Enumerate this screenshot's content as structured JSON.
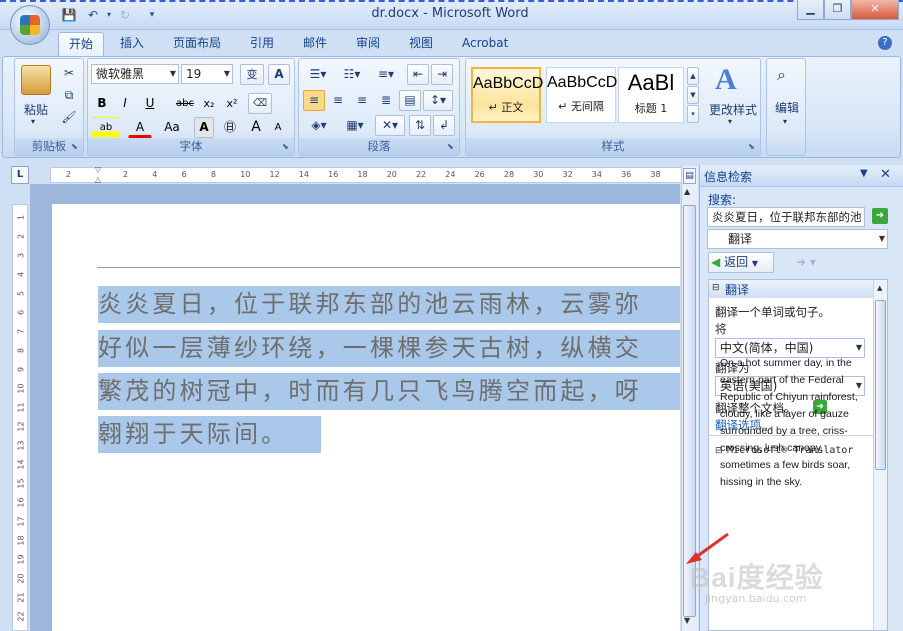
{
  "window": {
    "title": "dr.docx - Microsoft Word"
  },
  "tabs": [
    "开始",
    "插入",
    "页面布局",
    "引用",
    "邮件",
    "审阅",
    "视图",
    "Acrobat"
  ],
  "clipboard": {
    "paste": "粘贴",
    "group": "剪贴板"
  },
  "font": {
    "name": "微软雅黑",
    "size": "19",
    "group": "字体",
    "bold": "B",
    "italic": "I",
    "underline": "U",
    "strike": "abc",
    "sub": "x₂",
    "sup": "x²",
    "case": "Aa",
    "grow": "A",
    "shrink": "A",
    "wen": "变"
  },
  "paragraph": {
    "group": "段落"
  },
  "styles": {
    "group": "样式",
    "tiles": [
      {
        "sample": "AaBbCcD",
        "name": "↵ 正文"
      },
      {
        "sample": "AaBbCcD",
        "name": "↵ 无间隔"
      },
      {
        "sample": "AaBl",
        "name": "标题 1"
      }
    ],
    "change": "更改样式"
  },
  "editing": {
    "label": "编辑"
  },
  "ruler": {
    "corner": "L",
    "ticks": [
      "2",
      "2",
      "4",
      "6",
      "8",
      "10",
      "12",
      "14",
      "16",
      "18",
      "20",
      "22",
      "24",
      "26",
      "28",
      "30",
      "32",
      "34",
      "36",
      "38"
    ],
    "vticks": [
      "1",
      "2",
      "3",
      "4",
      "5",
      "6",
      "7",
      "8",
      "9",
      "10",
      "11",
      "12",
      "13",
      "14",
      "15",
      "16",
      "17",
      "18",
      "19",
      "20",
      "21",
      "22"
    ]
  },
  "doc": {
    "lines": [
      "炎炎夏日，位于联邦东部的池云雨林，云雾弥",
      "好似一层薄纱环绕，一棵棵参天古树，纵横交",
      "繁茂的树冠中，时而有几只飞鸟腾空而起，呀",
      "翱翔于天际间。"
    ]
  },
  "pane": {
    "title": "信息检索",
    "search_label": "搜索:",
    "search_value": "炎炎夏日，位于联邦东部的池",
    "service": "翻译",
    "back": "返回",
    "section": "翻译",
    "translate_hint": "翻译一个单词或句子。",
    "from_label": "将",
    "from_value": "中文(简体，中国)",
    "to_label": "翻译为",
    "to_value": "英语(美国)",
    "whole_doc": "翻译整个文档。",
    "options": "翻译选项...",
    "translator": "Microsoft® Translator",
    "result": "On a hot summer day, in the eastern part of the Federal Republic of Chiyun rainforest, cloudy, like a layer of gauze surrounded by a tree, criss-crossing, lush canopy, sometimes a few birds soar, hissing in the sky."
  },
  "watermark": {
    "text": "Bai度经验",
    "sub": "jingyan.baidu.com"
  },
  "colors": {
    "ribbon": "#dde9f8",
    "selection": "#a9c8ea",
    "text": "#15428b"
  }
}
